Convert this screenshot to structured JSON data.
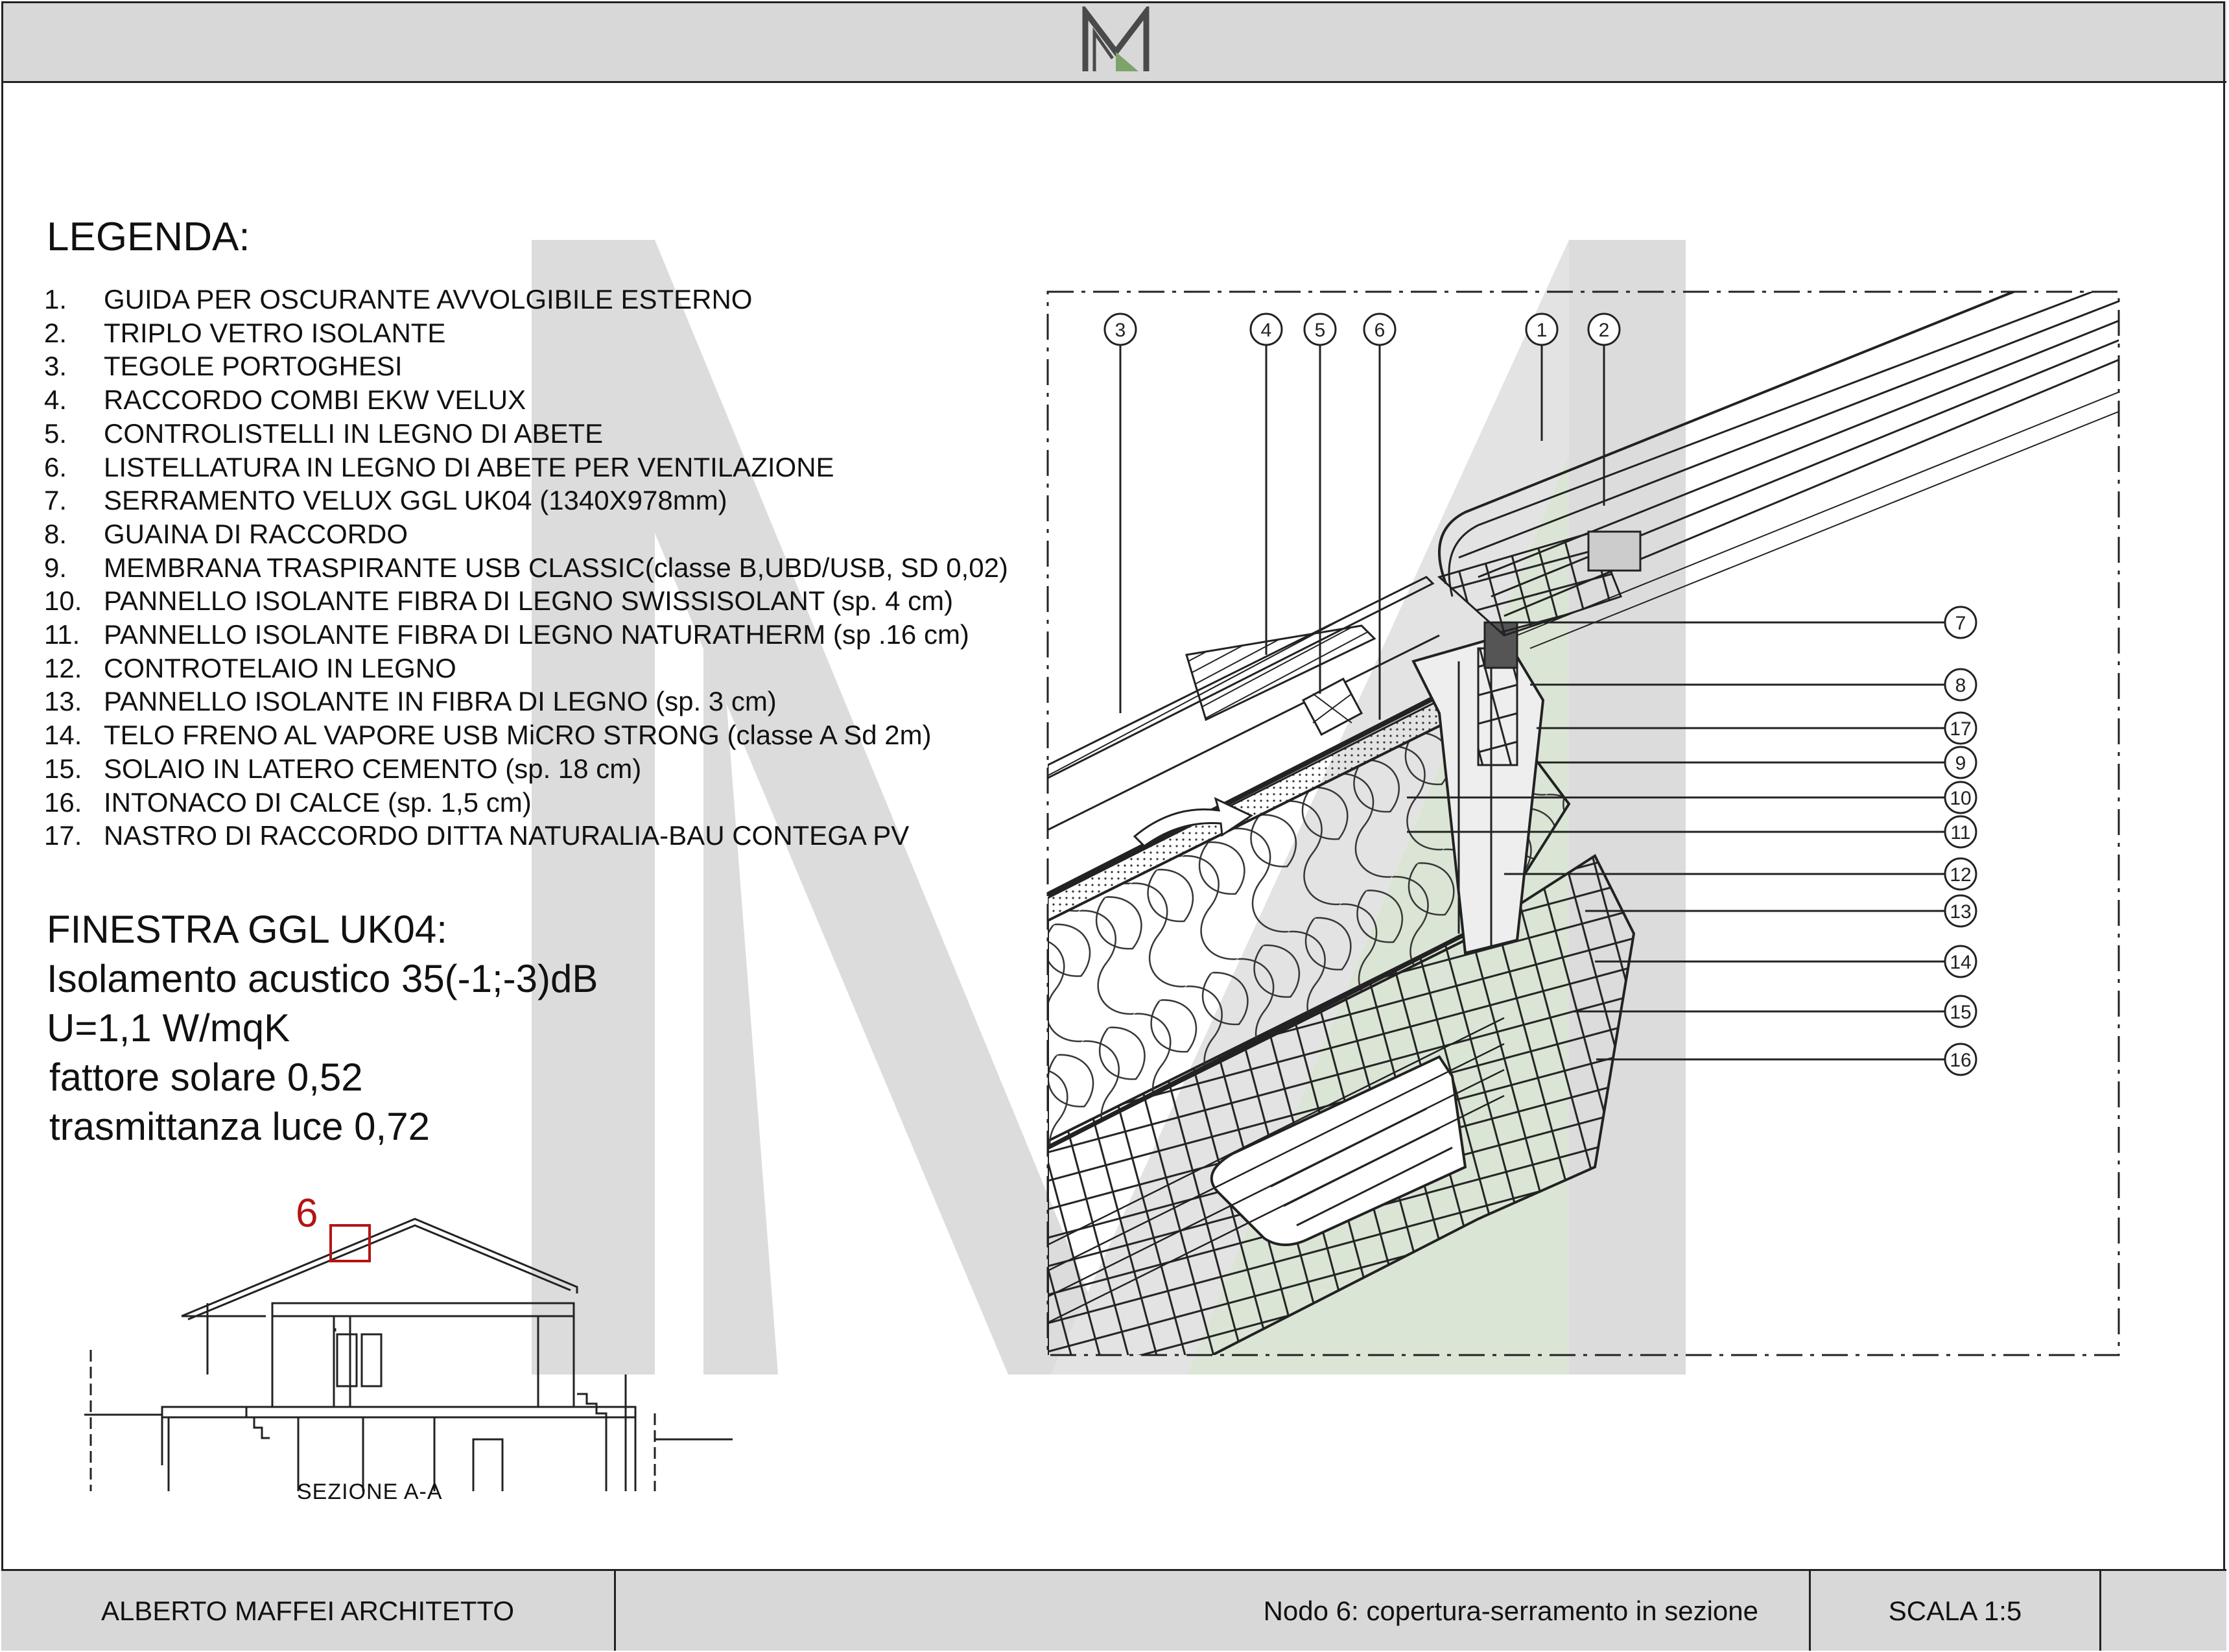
{
  "logo": {
    "letters": "M"
  },
  "legend": {
    "title": "LEGENDA:",
    "items": [
      {
        "num": "1.",
        "text": "GUIDA PER OSCURANTE AVVOLGIBILE ESTERNO"
      },
      {
        "num": "2.",
        "text": "TRIPLO VETRO ISOLANTE"
      },
      {
        "num": "3.",
        "text": "TEGOLE PORTOGHESI"
      },
      {
        "num": "4.",
        "text": "RACCORDO COMBI EKW VELUX"
      },
      {
        "num": "5.",
        "text": "CONTROLISTELLI  IN LEGNO DI ABETE"
      },
      {
        "num": "6.",
        "text": "LISTELLATURA IN LEGNO DI ABETE PER VENTILAZIONE"
      },
      {
        "num": "7.",
        "text": "SERRAMENTO VELUX GGL UK04 (1340X978mm)"
      },
      {
        "num": "8.",
        "text": "GUAINA DI RACCORDO"
      },
      {
        "num": "9.",
        "text": "MEMBRANA TRASPIRANTE USB CLASSIC(classe B,UBD/USB, SD 0,02)"
      },
      {
        "num": "10.",
        "text": "PANNELLO ISOLANTE FIBRA DI LEGNO SWISSISOLANT (sp. 4 cm)"
      },
      {
        "num": "11.",
        "text": "PANNELLO ISOLANTE FIBRA DI LEGNO NATURATHERM (sp .16 cm)"
      },
      {
        "num": "12.",
        "text": "CONTROTELAIO IN LEGNO"
      },
      {
        "num": "13.",
        "text": "PANNELLO ISOLANTE IN FIBRA DI LEGNO (sp. 3 cm)"
      },
      {
        "num": "14.",
        "text": "TELO FRENO AL VAPORE USB MiCRO STRONG (classe A Sd 2m)"
      },
      {
        "num": "15.",
        "text": "SOLAIO IN LATERO CEMENTO (sp. 18 cm)"
      },
      {
        "num": "16.",
        "text": "INTONACO DI CALCE (sp. 1,5 cm)"
      },
      {
        "num": "17.",
        "text": "NASTRO DI RACCORDO DITTA NATURALIA-BAU CONTEGA PV"
      }
    ]
  },
  "window_specs": {
    "title": "FINESTRA GGL UK04:",
    "lines": [
      "Isolamento acustico 35(-1;-3)dB",
      "U=1,1 W/mqK",
      "fattore solare 0,52",
      "trasmittanza luce 0,72"
    ]
  },
  "section": {
    "label": "SEZIONE A-A",
    "detail_number": "6"
  },
  "callouts": {
    "top": [
      "3",
      "4",
      "5",
      "6",
      "1",
      "2"
    ],
    "right": [
      "7",
      "8",
      "17",
      "9",
      "10",
      "11",
      "12",
      "13",
      "14",
      "15",
      "16"
    ]
  },
  "footer": {
    "author": "ALBERTO MAFFEI ARCHITETTO",
    "title": "Nodo 6: copertura-serramento in sezione",
    "scale": "SCALA 1:5"
  },
  "colors": {
    "header_bg": "#d8d8d8",
    "watermark_gray": "#dcdcdc",
    "watermark_green": "#dbe5d6",
    "accent_red": "#b31414"
  }
}
